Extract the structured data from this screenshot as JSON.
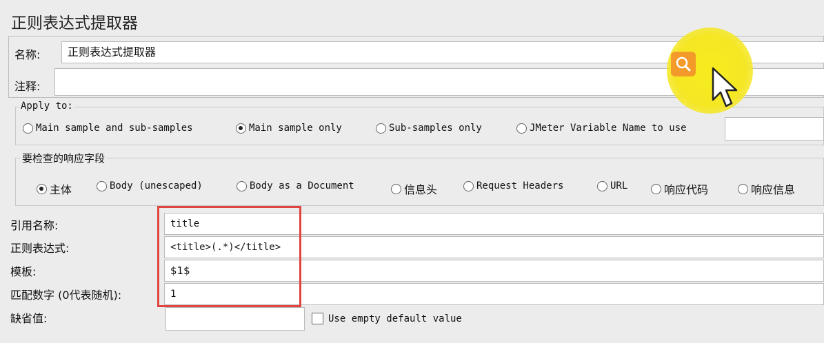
{
  "window": {
    "title": "正则表达式提取器"
  },
  "fields": {
    "name_label": "名称:",
    "name_value": "正则表达式提取器",
    "comment_label": "注释:",
    "comment_value": ""
  },
  "apply_to": {
    "title": "Apply to:",
    "options": [
      {
        "label": "Main sample and sub-samples",
        "selected": false
      },
      {
        "label": "Main sample only",
        "selected": true
      },
      {
        "label": "Sub-samples only",
        "selected": false
      },
      {
        "label": "JMeter Variable Name to use",
        "selected": false
      }
    ],
    "variable_value": ""
  },
  "response_field": {
    "title": "要检查的响应字段",
    "options": [
      {
        "label": "主体",
        "selected": true
      },
      {
        "label": "Body (unescaped)",
        "selected": false
      },
      {
        "label": "Body as a Document",
        "selected": false
      },
      {
        "label": "信息头",
        "selected": false
      },
      {
        "label": "Request Headers",
        "selected": false
      },
      {
        "label": "URL",
        "selected": false
      },
      {
        "label": "响应代码",
        "selected": false
      },
      {
        "label": "响应信息",
        "selected": false
      }
    ]
  },
  "extractor": {
    "ref_name_label": "引用名称:",
    "ref_name_value": "title",
    "regex_label": "正则表达式:",
    "regex_value": "<title>(.*)</title>",
    "template_label": "模板:",
    "template_value": "$1$",
    "match_no_label": "匹配数字 (0代表随机):",
    "match_no_value": "1",
    "default_label": "缺省值:",
    "default_value": "",
    "use_empty_label": "Use empty default value",
    "use_empty_checked": false
  },
  "overlay": {
    "icon": "search-icon",
    "badge_color": "#f39a2a",
    "halo_color": "#f5e724",
    "highlight_color": "#e0453f"
  }
}
